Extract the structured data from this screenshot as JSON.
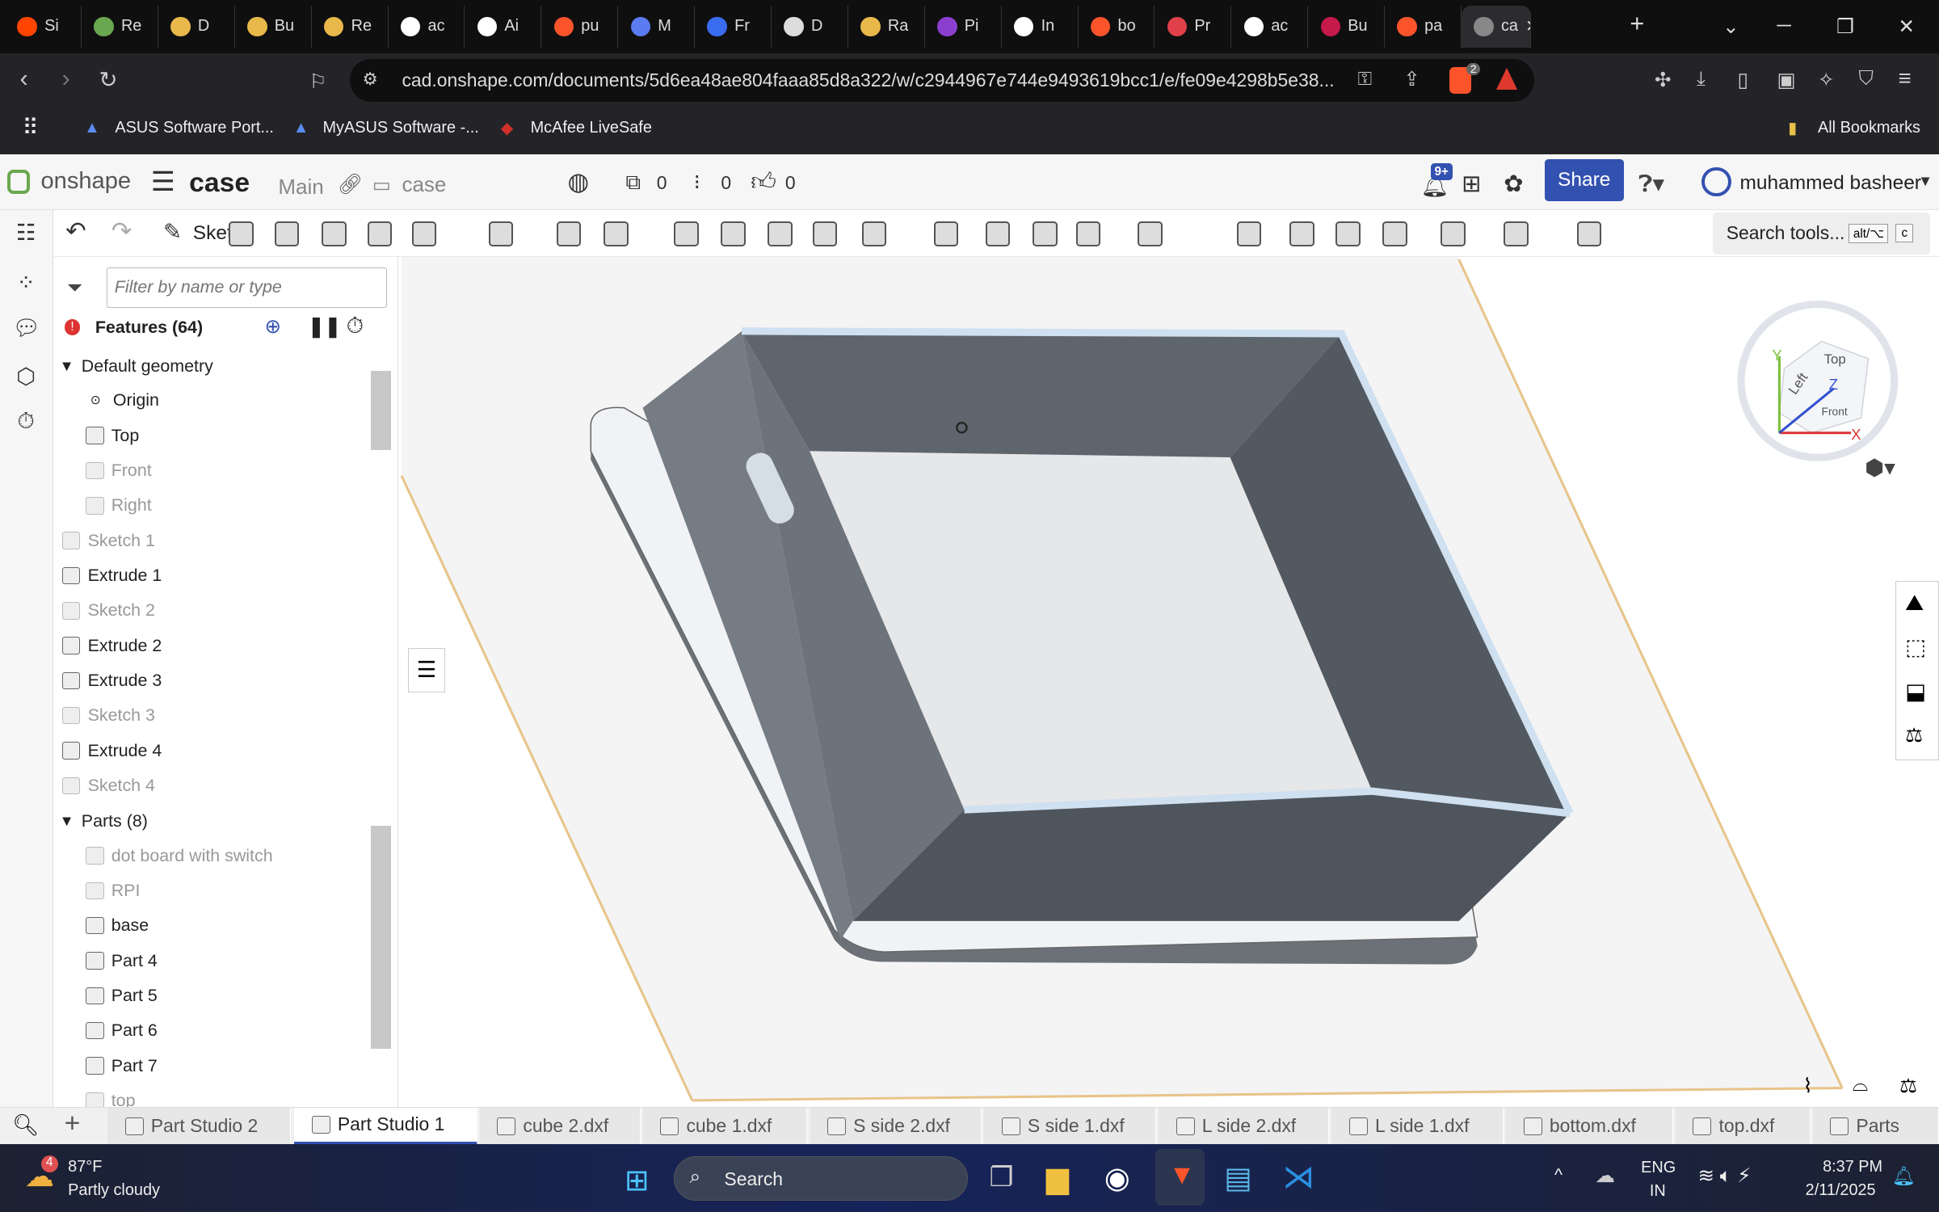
{
  "browser": {
    "tabs": [
      "Si",
      "Re",
      "D",
      "Bu",
      "Re",
      "ac",
      "Ai",
      "pu",
      "M",
      "Fr",
      "D",
      "Ra",
      "Pi",
      "In",
      "bo",
      "Pr",
      "ac",
      "Bu",
      "pa",
      "ca"
    ],
    "tab_colors": [
      "#ff4500",
      "#6aa84f",
      "#e8b84a",
      "#e8b84a",
      "#e8b84a",
      "#ffffff",
      "#ffffff",
      "#fb542b",
      "#5a7cf0",
      "#3a6cf0",
      "#dddddd",
      "#e8b84a",
      "#8a3fcf",
      "#ffffff",
      "#fb542b",
      "#e0404a",
      "#ffffff",
      "#c51a4a",
      "#fb542b",
      "#888888"
    ],
    "new_tab": "+",
    "close": "✕",
    "url": "cad.onshape.com/documents/5d6ea48ae804faaa85d8a322/w/c2944967e744e9493619bcc1/e/fe09e4298b5e38...",
    "brave_badge": "2",
    "bookmarks": [
      "ASUS Software Port...",
      "MyASUS Software -...",
      "McAfee LiveSafe"
    ],
    "all_bookmarks": "All Bookmarks"
  },
  "header": {
    "logo": "onshape",
    "doc": "case",
    "branch": "Main",
    "folder": "case",
    "count1": "0",
    "count2": "0",
    "count3": "0",
    "notif": "9+",
    "share": "Share",
    "user": "muhammed basheer",
    "accent": "#3351b0"
  },
  "toolbar": {
    "sketch": "Sketch",
    "search": "Search tools...",
    "kbd1": "alt/⌥",
    "kbd2": "c"
  },
  "features": {
    "filter_placeholder": "Filter by name or type",
    "title": "Features (64)",
    "default_geometry": "Default geometry",
    "items": [
      {
        "label": "Origin",
        "dim": false
      },
      {
        "label": "Top",
        "dim": false
      },
      {
        "label": "Front",
        "dim": true
      },
      {
        "label": "Right",
        "dim": true
      },
      {
        "label": "Sketch 1",
        "dim": true
      },
      {
        "label": "Extrude 1",
        "dim": false
      },
      {
        "label": "Sketch 2",
        "dim": true
      },
      {
        "label": "Extrude 2",
        "dim": false
      },
      {
        "label": "Extrude 3",
        "dim": false
      },
      {
        "label": "Sketch 3",
        "dim": true
      },
      {
        "label": "Extrude 4",
        "dim": false
      },
      {
        "label": "Sketch 4",
        "dim": true
      }
    ],
    "parts_title": "Parts (8)",
    "parts": [
      {
        "label": "dot board with switch",
        "dim": true
      },
      {
        "label": "RPI",
        "dim": true
      },
      {
        "label": "base",
        "dim": false
      },
      {
        "label": "Part 4",
        "dim": false
      },
      {
        "label": "Part 5",
        "dim": false
      },
      {
        "label": "Part 6",
        "dim": false
      },
      {
        "label": "Part 7",
        "dim": false
      },
      {
        "label": "top",
        "dim": true
      }
    ]
  },
  "viewcube": {
    "top": "Top",
    "left": "Left",
    "front": "Front",
    "x": "X",
    "y": "Y",
    "z": "Z"
  },
  "doc_tabs": [
    "Part Studio 2",
    "Part Studio 1",
    "cube 2.dxf",
    "cube 1.dxf",
    "S side 2.dxf",
    "S side 1.dxf",
    "L side 2.dxf",
    "L side 1.dxf",
    "bottom.dxf",
    "top.dxf",
    "Parts"
  ],
  "active_doc_tab": "Part Studio 1",
  "taskbar": {
    "temp": "87°F",
    "weather": "Partly cloudy",
    "weather_badge": "4",
    "search": "Search",
    "lang1": "ENG",
    "lang2": "IN",
    "time": "8:37 PM",
    "date": "2/11/2025"
  }
}
